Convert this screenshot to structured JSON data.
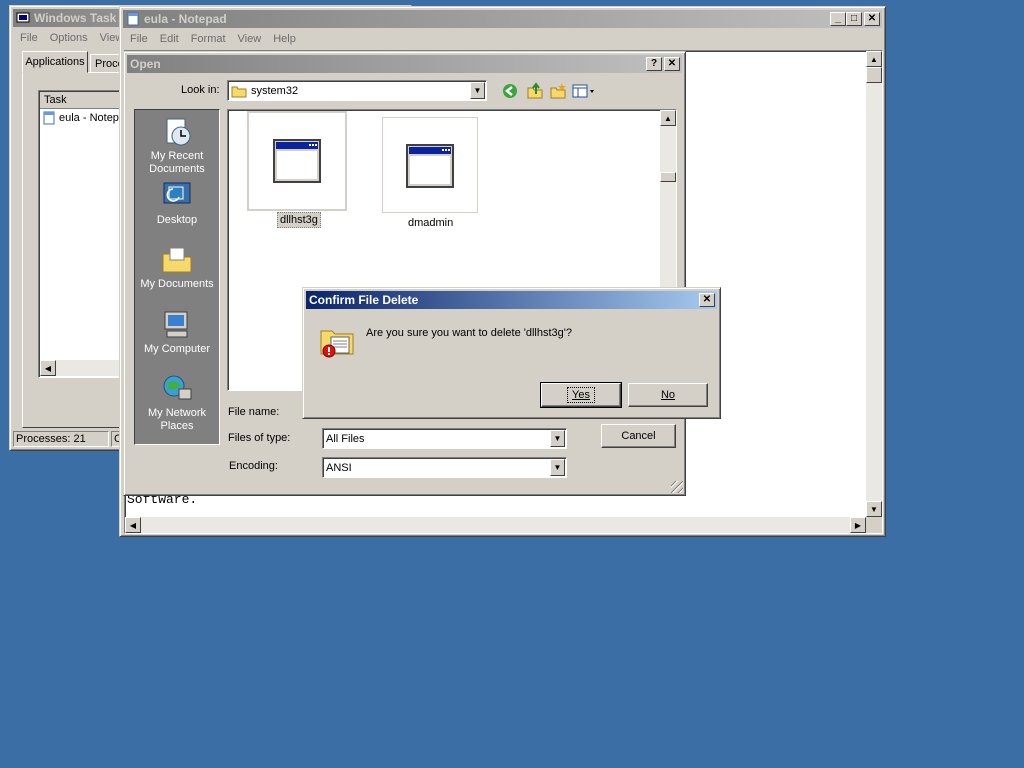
{
  "task_manager": {
    "title": "Windows Task M",
    "menu": [
      "File",
      "Options",
      "View"
    ],
    "tabs": [
      "Applications",
      "Proce"
    ],
    "column_header": "Task",
    "row": "eula - Notep",
    "status_processes": "Processes: 21",
    "status_cpu": "C"
  },
  "notepad": {
    "title": "eula - Notepad",
    "menu": [
      "File",
      "Edit",
      "Format",
      "View",
      "Help"
    ],
    "text_visible": "Software."
  },
  "open_dialog": {
    "title": "Open",
    "help_btn": "?",
    "look_in_label": "Look in:",
    "look_in_value": "system32",
    "places": [
      "My Recent Documents",
      "Desktop",
      "My Documents",
      "My Computer",
      "My Network Places"
    ],
    "files": [
      "dllhst3g",
      "dmadmin"
    ],
    "file_name_label": "File name:",
    "files_of_type_label": "Files of type:",
    "files_of_type_value": "All Files",
    "encoding_label": "Encoding:",
    "encoding_value": "ANSI",
    "cancel_label": "Cancel"
  },
  "confirm": {
    "title": "Confirm File Delete",
    "message": "Are you sure you want to delete 'dllhst3g'?",
    "yes_label": "Yes",
    "no_label": "No"
  },
  "colors": {
    "desktop": "#3a6ea5",
    "active_title": "#0a246a",
    "inactive_title": "#808080",
    "face": "#d4d0c8"
  }
}
